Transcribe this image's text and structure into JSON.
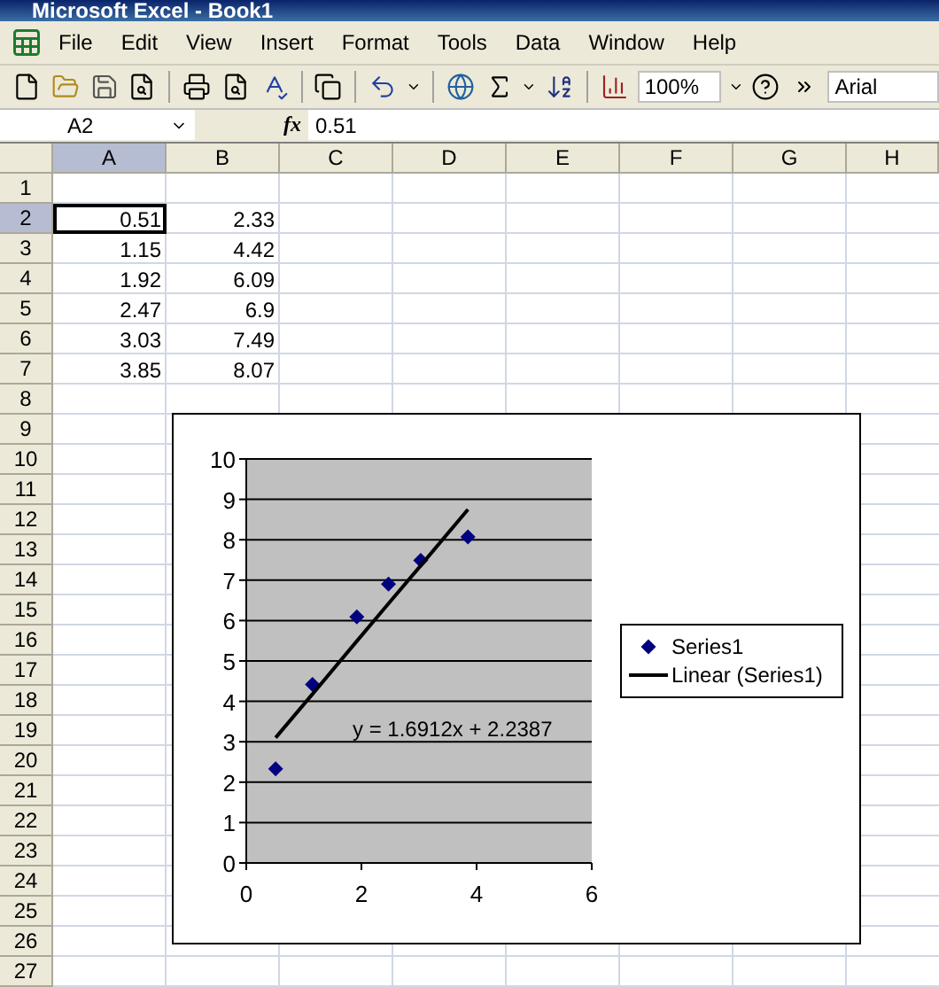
{
  "window": {
    "title": "Microsoft Excel - Book1"
  },
  "menu": [
    "File",
    "Edit",
    "View",
    "Insert",
    "Format",
    "Tools",
    "Data",
    "Window",
    "Help"
  ],
  "toolbar": {
    "zoom": "100%",
    "font": "Arial"
  },
  "formula_bar": {
    "name_box": "A2",
    "fx": "fx",
    "value": "0.51"
  },
  "columns": [
    {
      "label": "A",
      "selected": true
    },
    {
      "label": "B",
      "selected": false
    },
    {
      "label": "C",
      "selected": false
    },
    {
      "label": "D",
      "selected": false
    },
    {
      "label": "E",
      "selected": false
    },
    {
      "label": "F",
      "selected": false
    },
    {
      "label": "G",
      "selected": false
    },
    {
      "label": "H",
      "selected": false
    }
  ],
  "rows": [
    {
      "header": "1",
      "selected": false,
      "cells": []
    },
    {
      "header": "2",
      "selected": true,
      "cells": [
        {
          "value": "0.51",
          "selected": true
        },
        {
          "value": "2.33",
          "selected": false
        }
      ]
    },
    {
      "header": "3",
      "selected": false,
      "cells": [
        {
          "value": "1.15",
          "selected": false
        },
        {
          "value": "4.42",
          "selected": false
        }
      ]
    },
    {
      "header": "4",
      "selected": false,
      "cells": [
        {
          "value": "1.92",
          "selected": false
        },
        {
          "value": "6.09",
          "selected": false
        }
      ]
    },
    {
      "header": "5",
      "selected": false,
      "cells": [
        {
          "value": "2.47",
          "selected": false
        },
        {
          "value": "6.9",
          "selected": false
        }
      ]
    },
    {
      "header": "6",
      "selected": false,
      "cells": [
        {
          "value": "3.03",
          "selected": false
        },
        {
          "value": "7.49",
          "selected": false
        }
      ]
    },
    {
      "header": "7",
      "selected": false,
      "cells": [
        {
          "value": "3.85",
          "selected": false
        },
        {
          "value": "8.07",
          "selected": false
        }
      ]
    },
    {
      "header": "8",
      "selected": false,
      "cells": []
    },
    {
      "header": "9",
      "selected": false,
      "cells": []
    },
    {
      "header": "10",
      "selected": false,
      "cells": []
    },
    {
      "header": "11",
      "selected": false,
      "cells": []
    },
    {
      "header": "12",
      "selected": false,
      "cells": []
    },
    {
      "header": "13",
      "selected": false,
      "cells": []
    },
    {
      "header": "14",
      "selected": false,
      "cells": []
    },
    {
      "header": "15",
      "selected": false,
      "cells": []
    },
    {
      "header": "16",
      "selected": false,
      "cells": []
    },
    {
      "header": "17",
      "selected": false,
      "cells": []
    },
    {
      "header": "18",
      "selected": false,
      "cells": []
    },
    {
      "header": "19",
      "selected": false,
      "cells": []
    },
    {
      "header": "20",
      "selected": false,
      "cells": []
    },
    {
      "header": "21",
      "selected": false,
      "cells": []
    },
    {
      "header": "22",
      "selected": false,
      "cells": []
    },
    {
      "header": "23",
      "selected": false,
      "cells": []
    },
    {
      "header": "24",
      "selected": false,
      "cells": []
    },
    {
      "header": "25",
      "selected": false,
      "cells": []
    },
    {
      "header": "26",
      "selected": false,
      "cells": []
    },
    {
      "header": "27",
      "selected": false,
      "cells": []
    }
  ],
  "chart": {
    "chart_data": {
      "type": "scatter",
      "x": [
        0.51,
        1.15,
        1.92,
        2.47,
        3.03,
        3.85
      ],
      "grid": true,
      "series": [
        {
          "name": "Series1",
          "type": "scatter",
          "color": "#000080",
          "values": [
            2.33,
            4.42,
            6.09,
            6.9,
            7.49,
            8.07
          ]
        },
        {
          "name": "Linear (Series1)",
          "type": "line",
          "color": "#000000",
          "values": [
            3.1,
            4.18,
            5.49,
            6.42,
            7.36,
            8.75
          ]
        }
      ],
      "xlim": [
        0,
        6
      ],
      "ylim": [
        0,
        10
      ],
      "xticks": [
        0,
        2,
        4,
        6
      ],
      "yticks": [
        0,
        1,
        2,
        3,
        4,
        5,
        6,
        7,
        8,
        9,
        10
      ],
      "annotations": [
        "y = 1.6912x + 2.2387"
      ]
    }
  }
}
